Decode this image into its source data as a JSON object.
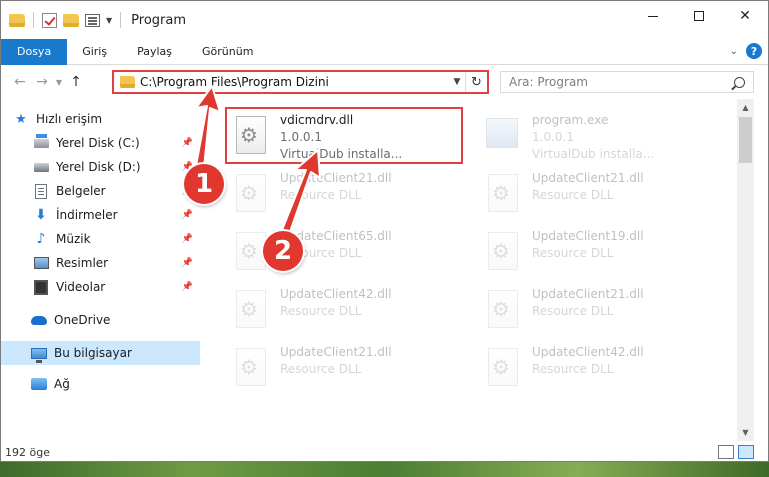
{
  "window": {
    "title": "Program",
    "controls": {
      "minimize": "—",
      "maximize": "☐",
      "close": "✕"
    }
  },
  "ribbon": {
    "tabs": [
      "Dosya",
      "Giriş",
      "Paylaş",
      "Görünüm"
    ],
    "help": "?"
  },
  "nav": {
    "address": "C:\\Program Files\\Program Dizini",
    "search_placeholder": "Ara: Program"
  },
  "sidebar": {
    "items": [
      {
        "label": "Hızlı erişim",
        "icon": "star-icon"
      },
      {
        "label": "Yerel Disk (C:)",
        "icon": "windows-disk-icon"
      },
      {
        "label": "Yerel Disk (D:)",
        "icon": "disk-icon"
      },
      {
        "label": "Belgeler",
        "icon": "documents-icon"
      },
      {
        "label": "İndirmeler",
        "icon": "downloads-icon"
      },
      {
        "label": "Müzik",
        "icon": "music-icon"
      },
      {
        "label": "Resimler",
        "icon": "pictures-icon"
      },
      {
        "label": "Videolar",
        "icon": "videos-icon"
      },
      {
        "label": "OneDrive",
        "icon": "cloud-icon"
      },
      {
        "label": "Bu bilgisayar",
        "icon": "computer-icon"
      },
      {
        "label": "Ağ",
        "icon": "network-icon"
      }
    ]
  },
  "files": [
    {
      "name": "vdicmdrv.dll",
      "line2": "1.0.0.1",
      "line3": "VirtualDub installa...",
      "icon": "dll-gear-icon"
    },
    {
      "name": "program.exe",
      "line2": "1.0.0.1",
      "line3": "VirtualDub installa...",
      "icon": "exe-icon"
    },
    {
      "name": "UpdateClient21.dll",
      "line2": "Resource DLL",
      "icon": "dll-gear-icon"
    },
    {
      "name": "UpdateClient21.dll",
      "line2": "Resource DLL",
      "icon": "dll-gear-icon"
    },
    {
      "name": "UpdateClient65.dll",
      "line2": "Resource DLL",
      "icon": "dll-gear-icon"
    },
    {
      "name": "UpdateClient19.dll",
      "line2": "Resource DLL",
      "icon": "dll-gear-icon"
    },
    {
      "name": "UpdateClient42.dll",
      "line2": "Resource DLL",
      "icon": "dll-gear-icon"
    },
    {
      "name": "UpdateClient21.dll",
      "line2": "Resource DLL",
      "icon": "dll-gear-icon"
    },
    {
      "name": "UpdateClient21.dll",
      "line2": "Resource DLL",
      "icon": "dll-gear-icon"
    },
    {
      "name": "UpdateClient42.dll",
      "line2": "Resource DLL",
      "icon": "dll-gear-icon"
    }
  ],
  "status": {
    "count": "192 öge"
  },
  "annotations": {
    "callout1": "1",
    "callout2": "2",
    "color": "#e0372f"
  }
}
